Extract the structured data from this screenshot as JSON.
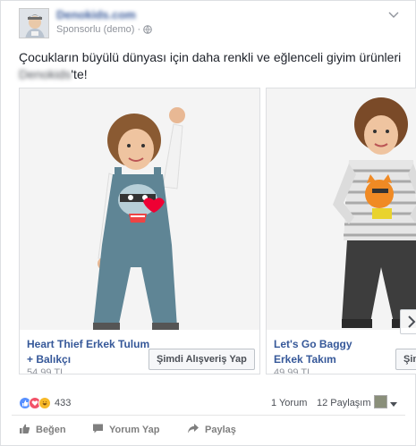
{
  "post": {
    "page_name": "Denokids.com",
    "sponsored_label": "Sponsorlu (demo)",
    "separator": "·",
    "text_line1": "Çocukların büyülü dünyası için daha renkli ve eğlenceli giyim ürünleri",
    "text_blurred": "Denokids",
    "text_suffix": "'te!"
  },
  "carousel": {
    "items": [
      {
        "title": "Heart Thief Erkek Tulum + Balıkçı",
        "price": "54.99 TL",
        "cta": "Şimdi Alışveriş Yap"
      },
      {
        "title": "Let's Go Baggy Erkek Takım",
        "price": "49.99 TL",
        "cta": "Şimdi Alışveriş Yap"
      }
    ]
  },
  "stats": {
    "reaction_count": "433",
    "comments": "1 Yorum",
    "shares": "12 Paylaşım"
  },
  "actions": {
    "like": "Beğen",
    "comment": "Yorum Yap",
    "share": "Paylaş"
  },
  "colors": {
    "link": "#365899",
    "like_blue": "#5890ff",
    "love_red": "#f25268",
    "haha_yellow": "#f7b928"
  }
}
